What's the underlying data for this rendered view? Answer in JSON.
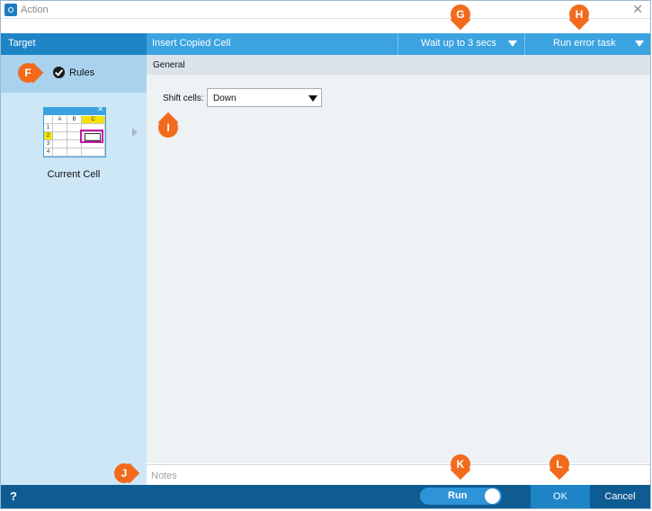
{
  "window": {
    "title": "Action",
    "close_glyph": "✕"
  },
  "header": {
    "target_label": "Target",
    "action_title": "Insert Copied Cell",
    "wait_dropdown": "Wait up to 3 secs",
    "error_dropdown": "Run error task"
  },
  "sidebar": {
    "rules_label": "Rules",
    "cell_item_label": "Current Cell",
    "grid": {
      "columns": [
        "A",
        "B",
        "C"
      ],
      "rows": [
        "1",
        "2",
        "3",
        "4"
      ],
      "highlight_column": "C",
      "highlight_row": "2",
      "highlight_color": "#f6e200",
      "selection_color": "#c21aa3"
    }
  },
  "main": {
    "section_title": "General",
    "shift_cells_label": "Shift cells:",
    "shift_cells_value": "Down"
  },
  "notes": {
    "placeholder": "Notes"
  },
  "footer": {
    "help_label": "?",
    "run_label": "Run",
    "ok_label": "OK",
    "cancel_label": "Cancel"
  },
  "markers": {
    "f": "F",
    "g": "G",
    "h": "H",
    "i": "I",
    "j": "J",
    "k": "K",
    "l": "L",
    "color": "#f26b1d"
  },
  "colors": {
    "header_target": "#1d84c6",
    "header_action": "#3aa3e0",
    "sidebar_bg": "#cde7f6",
    "footer_bg": "#0f5c93"
  }
}
